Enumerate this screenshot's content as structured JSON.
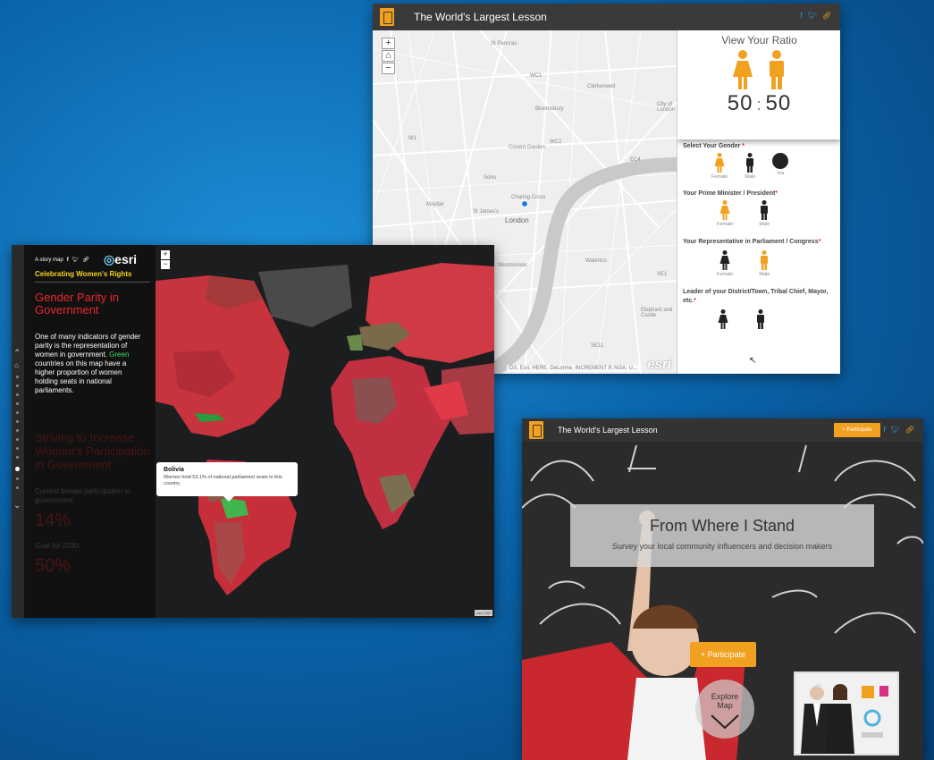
{
  "shot1": {
    "header_title": "The World's Largest Lesson",
    "header_icons": [
      "facebook-icon",
      "twitter-icon",
      "link-icon"
    ],
    "map_zoom_in": "+",
    "map_zoom_out": "−",
    "map_labels": [
      "St Pancras",
      "Bloomsbury",
      "Clerkenwell",
      "WC2",
      "Covent Garden",
      "Soho",
      "Mayfair",
      "St James's",
      "London",
      "Westminster",
      "Waterloo",
      "City of London",
      "EC4",
      "WC1",
      "W1",
      "Elephant and Castle",
      "SE11",
      "SE1"
    ],
    "location_label": "Charing Cross",
    "attribution": "DS, Esri, HERE, DeLorme, INCREMENT P, NGA, U...",
    "esri_watermark": "esri",
    "panel": {
      "ratio_title": "View Your Ratio",
      "ratio_left": "50",
      "ratio_sep": ":",
      "ratio_right": "50",
      "q1": "Select Your Gender",
      "q1_opts": [
        "Female",
        "Male",
        "n/a"
      ],
      "q2": "Your Prime Minister / President",
      "q2_opts": [
        "Female",
        "Male"
      ],
      "q3": "Your Representative in Parliament / Congress",
      "q3_opts": [
        "Female",
        "Male"
      ],
      "q4": "Leader of your District/Town, Tribal Chief, Mayor, etc.",
      "req": "*"
    },
    "colors": {
      "accent": "#f2a01f",
      "header": "#3a3a3a"
    }
  },
  "shot2": {
    "story_label": "A story map",
    "esri_logo": "esri",
    "subtitle": "Celebrating Women's Rights",
    "section_title": "Gender Parity in Government",
    "body_before": "One of many indicators of gender parity is the representation of women in government.",
    "body_green": "Green",
    "body_after": "countries on this map have a higher proportion of women holding seats in national parliaments.",
    "next_title": "Striving to Increase Women's Participation in Government",
    "current_caption": "Current female participation in government:",
    "current_value": "14%",
    "goal_caption": "Goal for 2030:",
    "goal_value": "50%",
    "popup_title": "Bolivia",
    "popup_body": "Women hold 53.1% of national parliament seats in this country.",
    "zoom_in": "+",
    "zoom_out": "−",
    "attribution": "esri | NG",
    "colors": {
      "title": "#e8282b",
      "subtitle": "#f6d21c",
      "green": "#3fdc5a"
    }
  },
  "shot3": {
    "header_title": "The World's Largest Lesson",
    "header_participate": "+ Participate",
    "hero_title": "From Where I Stand",
    "hero_subtitle": "Survey your local community influencers and decision makers",
    "participate_button": "+ Participate",
    "explore_label": "Explore Map",
    "colors": {
      "accent": "#f2a01f"
    }
  }
}
